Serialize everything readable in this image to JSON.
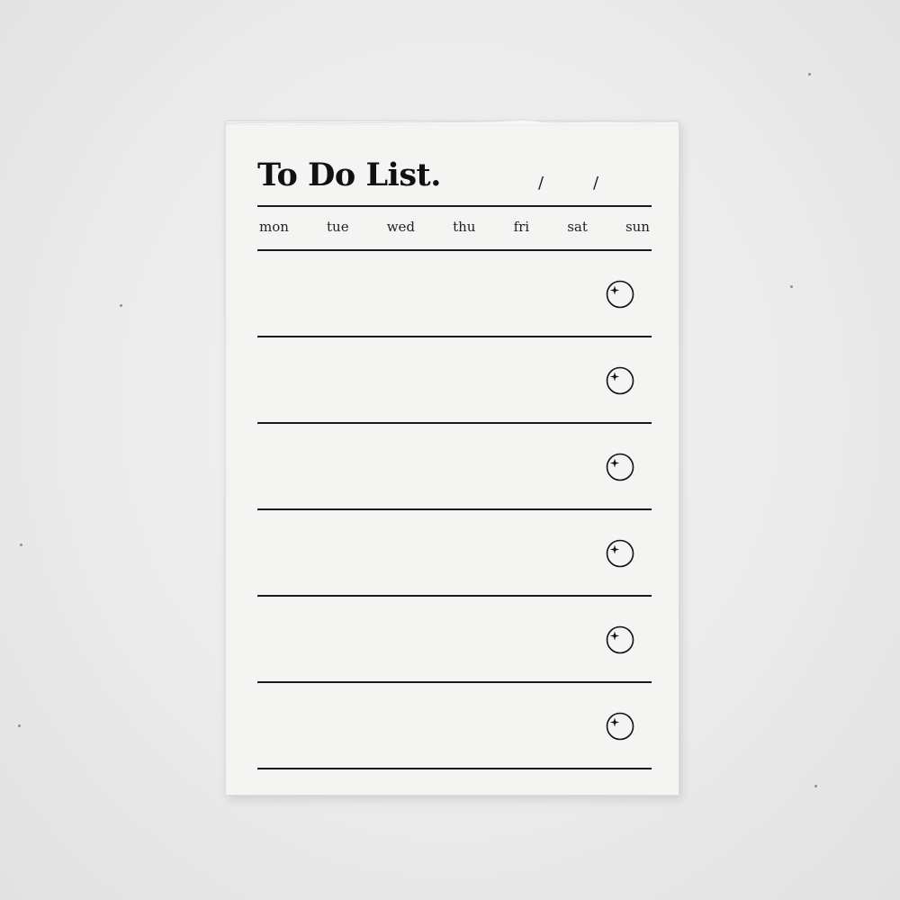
{
  "notepad": {
    "title": "To Do List.",
    "date_separators": [
      "/",
      "/"
    ],
    "days": [
      "mon",
      "tue",
      "wed",
      "thu",
      "fri",
      "sat",
      "sun"
    ],
    "rows": [
      {
        "icon": "sparkle-circle-icon"
      },
      {
        "icon": "sparkle-circle-icon"
      },
      {
        "icon": "sparkle-circle-icon"
      },
      {
        "icon": "sparkle-circle-icon"
      },
      {
        "icon": "sparkle-circle-icon"
      },
      {
        "icon": "sparkle-circle-icon"
      }
    ]
  },
  "colors": {
    "background": "#ebebeb",
    "paper": "#f4f4f2",
    "ink": "#111111"
  }
}
